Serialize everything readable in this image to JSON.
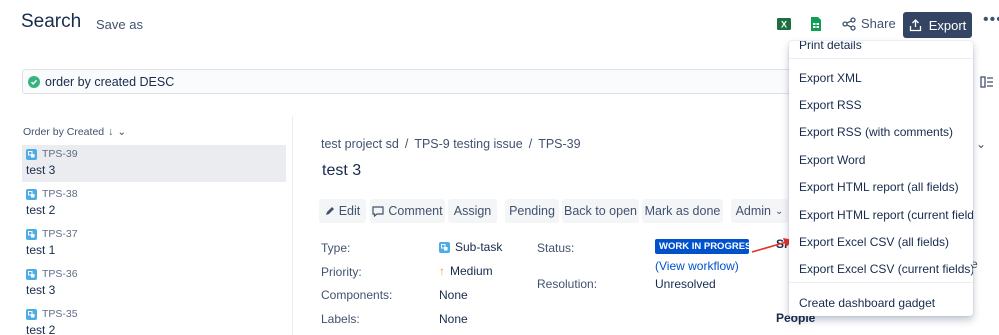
{
  "header": {
    "title": "Search",
    "save_as": "Save as",
    "share": "Share",
    "export": "Export",
    "more": "•••"
  },
  "jql": {
    "query": "order by created DESC",
    "status_color": "#36b37e"
  },
  "list": {
    "order_label": "Order by Created",
    "items": [
      {
        "key": "TPS-39",
        "summary": "test 3",
        "selected": true
      },
      {
        "key": "TPS-38",
        "summary": "test 2",
        "selected": false
      },
      {
        "key": "TPS-37",
        "summary": "test 1",
        "selected": false
      },
      {
        "key": "TPS-36",
        "summary": "test 3",
        "selected": false
      },
      {
        "key": "TPS-35",
        "summary": "test 2",
        "selected": false
      }
    ]
  },
  "issue": {
    "breadcrumb": [
      "test project sd",
      "/",
      "TPS-9 testing issue",
      "/",
      "TPS-39"
    ],
    "title": "test 3",
    "toolbar": {
      "edit": "Edit",
      "comment": "Comment",
      "assign": "Assign",
      "pending": "Pending",
      "back_to_open": "Back to open",
      "mark_as_done": "Mark as done",
      "admin": "Admin"
    },
    "fields": {
      "type_label": "Type:",
      "type_value": "Sub-task",
      "priority_label": "Priority:",
      "priority_value": "Medium",
      "components_label": "Components:",
      "components_value": "None",
      "labels_label": "Labels:",
      "labels_value": "None",
      "status_label": "Status:",
      "status_value": "WORK IN PROGRESS",
      "view_workflow": "(View workflow)",
      "resolution_label": "Resolution:",
      "resolution_value": "Unresolved"
    },
    "side": {
      "sl": "Sl",
      "e": "e",
      "people": "People"
    }
  },
  "export_menu": {
    "items": [
      "Print details",
      "Export XML",
      "Export RSS",
      "Export RSS (with comments)",
      "Export Word",
      "Export HTML report (all fields)",
      "Export HTML report (current fields)",
      "Export Excel CSV (all fields)",
      "Export Excel CSV (current fields)",
      "Create dashboard gadget"
    ]
  },
  "colors": {
    "export_button": "#344563",
    "status_lozenge": "#0052cc",
    "annotation_arrow": "#e5312a",
    "excel_icon": "#1d6f42",
    "sheets_icon": "#0f9d58"
  }
}
